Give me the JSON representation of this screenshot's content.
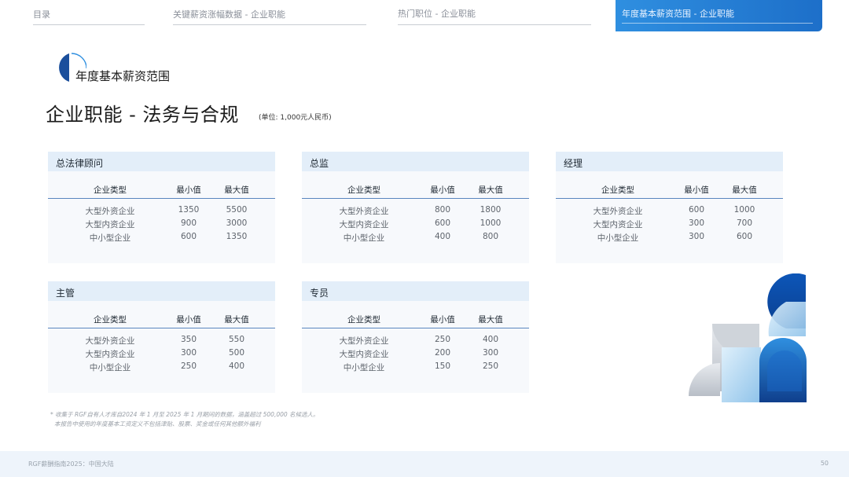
{
  "nav": {
    "tabs": [
      {
        "label": "目录"
      },
      {
        "label": "关键薪资涨幅数据 - 企业职能"
      },
      {
        "label": "热门职位 - 企业职能"
      },
      {
        "label": "年度基本薪资范围 - 企业职能",
        "active": true
      }
    ]
  },
  "section_title": "年度基本薪资范围",
  "page_title": "企业职能 - 法务与合规",
  "unit_note": "(单位: 1,000元人民币)",
  "table_headers": {
    "type": "企业类型",
    "min": "最小值",
    "max": "最大值"
  },
  "cards": [
    {
      "title": "总法律顾问",
      "rows": [
        {
          "type": "大型外资企业",
          "min": "1350",
          "max": "5500"
        },
        {
          "type": "大型内资企业",
          "min": "900",
          "max": "3000"
        },
        {
          "type": "中小型企业",
          "min": "600",
          "max": "1350"
        }
      ]
    },
    {
      "title": "总监",
      "rows": [
        {
          "type": "大型外资企业",
          "min": "800",
          "max": "1800"
        },
        {
          "type": "大型内资企业",
          "min": "600",
          "max": "1000"
        },
        {
          "type": "中小型企业",
          "min": "400",
          "max": "800"
        }
      ]
    },
    {
      "title": "经理",
      "rows": [
        {
          "type": "大型外资企业",
          "min": "600",
          "max": "1000"
        },
        {
          "type": "大型内资企业",
          "min": "300",
          "max": "700"
        },
        {
          "type": "中小型企业",
          "min": "300",
          "max": "600"
        }
      ]
    },
    {
      "title": "主管",
      "rows": [
        {
          "type": "大型外资企业",
          "min": "350",
          "max": "550"
        },
        {
          "type": "大型内资企业",
          "min": "300",
          "max": "500"
        },
        {
          "type": "中小型企业",
          "min": "250",
          "max": "400"
        }
      ]
    },
    {
      "title": "专员",
      "rows": [
        {
          "type": "大型外资企业",
          "min": "250",
          "max": "400"
        },
        {
          "type": "大型内资企业",
          "min": "200",
          "max": "300"
        },
        {
          "type": "中小型企业",
          "min": "150",
          "max": "250"
        }
      ]
    }
  ],
  "footnotes": [
    "* 收集于 RGF自有人才库自2024 年 1 月至 2025 年 1 月期间的数据，涵盖超过 500,000 名候选人。",
    "本报告中使用的年度基本工资定义不包括津贴、股票、奖金或任何其他额外福利"
  ],
  "footer": {
    "text": "RGF薪酬指南2025：中国大陆",
    "page_number": "50"
  },
  "colors": {
    "accent": "#1d6fc9",
    "header_bg": "#e3eef9",
    "card_bg": "#f7f9fc",
    "table_rule": "#5a86bf"
  },
  "icons": {
    "logo": "half-circle-logo-icon"
  }
}
